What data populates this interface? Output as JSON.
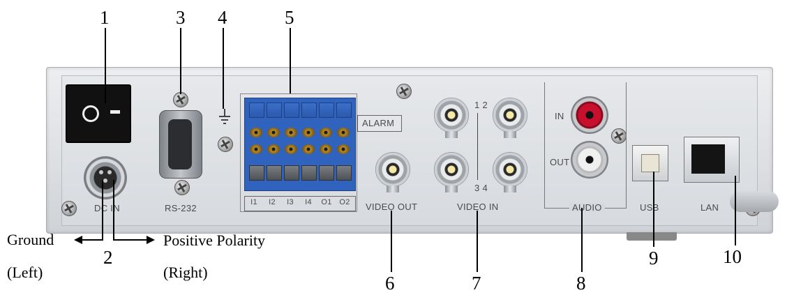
{
  "callouts": [
    "1",
    "2",
    "3",
    "4",
    "5",
    "6",
    "7",
    "8",
    "9",
    "10"
  ],
  "dc_labels": {
    "ground": "Ground",
    "ground_side": "(Left)",
    "positive": "Positive Polarity",
    "positive_side": "(Right)"
  },
  "panel_labels": {
    "dc_in": "DC IN",
    "rs232": "RS-232",
    "alarm": "ALARM",
    "terminals": [
      "I1",
      "I2",
      "I3",
      "I4",
      "O1",
      "O2"
    ],
    "video_out": "VIDEO OUT",
    "video_in": "VIDEO IN",
    "video_in_top": "1 2",
    "video_in_bottom": "3 4",
    "audio_in": "IN",
    "audio_out": "OUT",
    "audio": "AUDIO",
    "usb": "USB",
    "lan": "LAN"
  },
  "colors": {
    "panel": "#dcdee1",
    "terminal_block": "#2f63bd",
    "rca_red": "#c8102e",
    "switch": "#111111"
  }
}
